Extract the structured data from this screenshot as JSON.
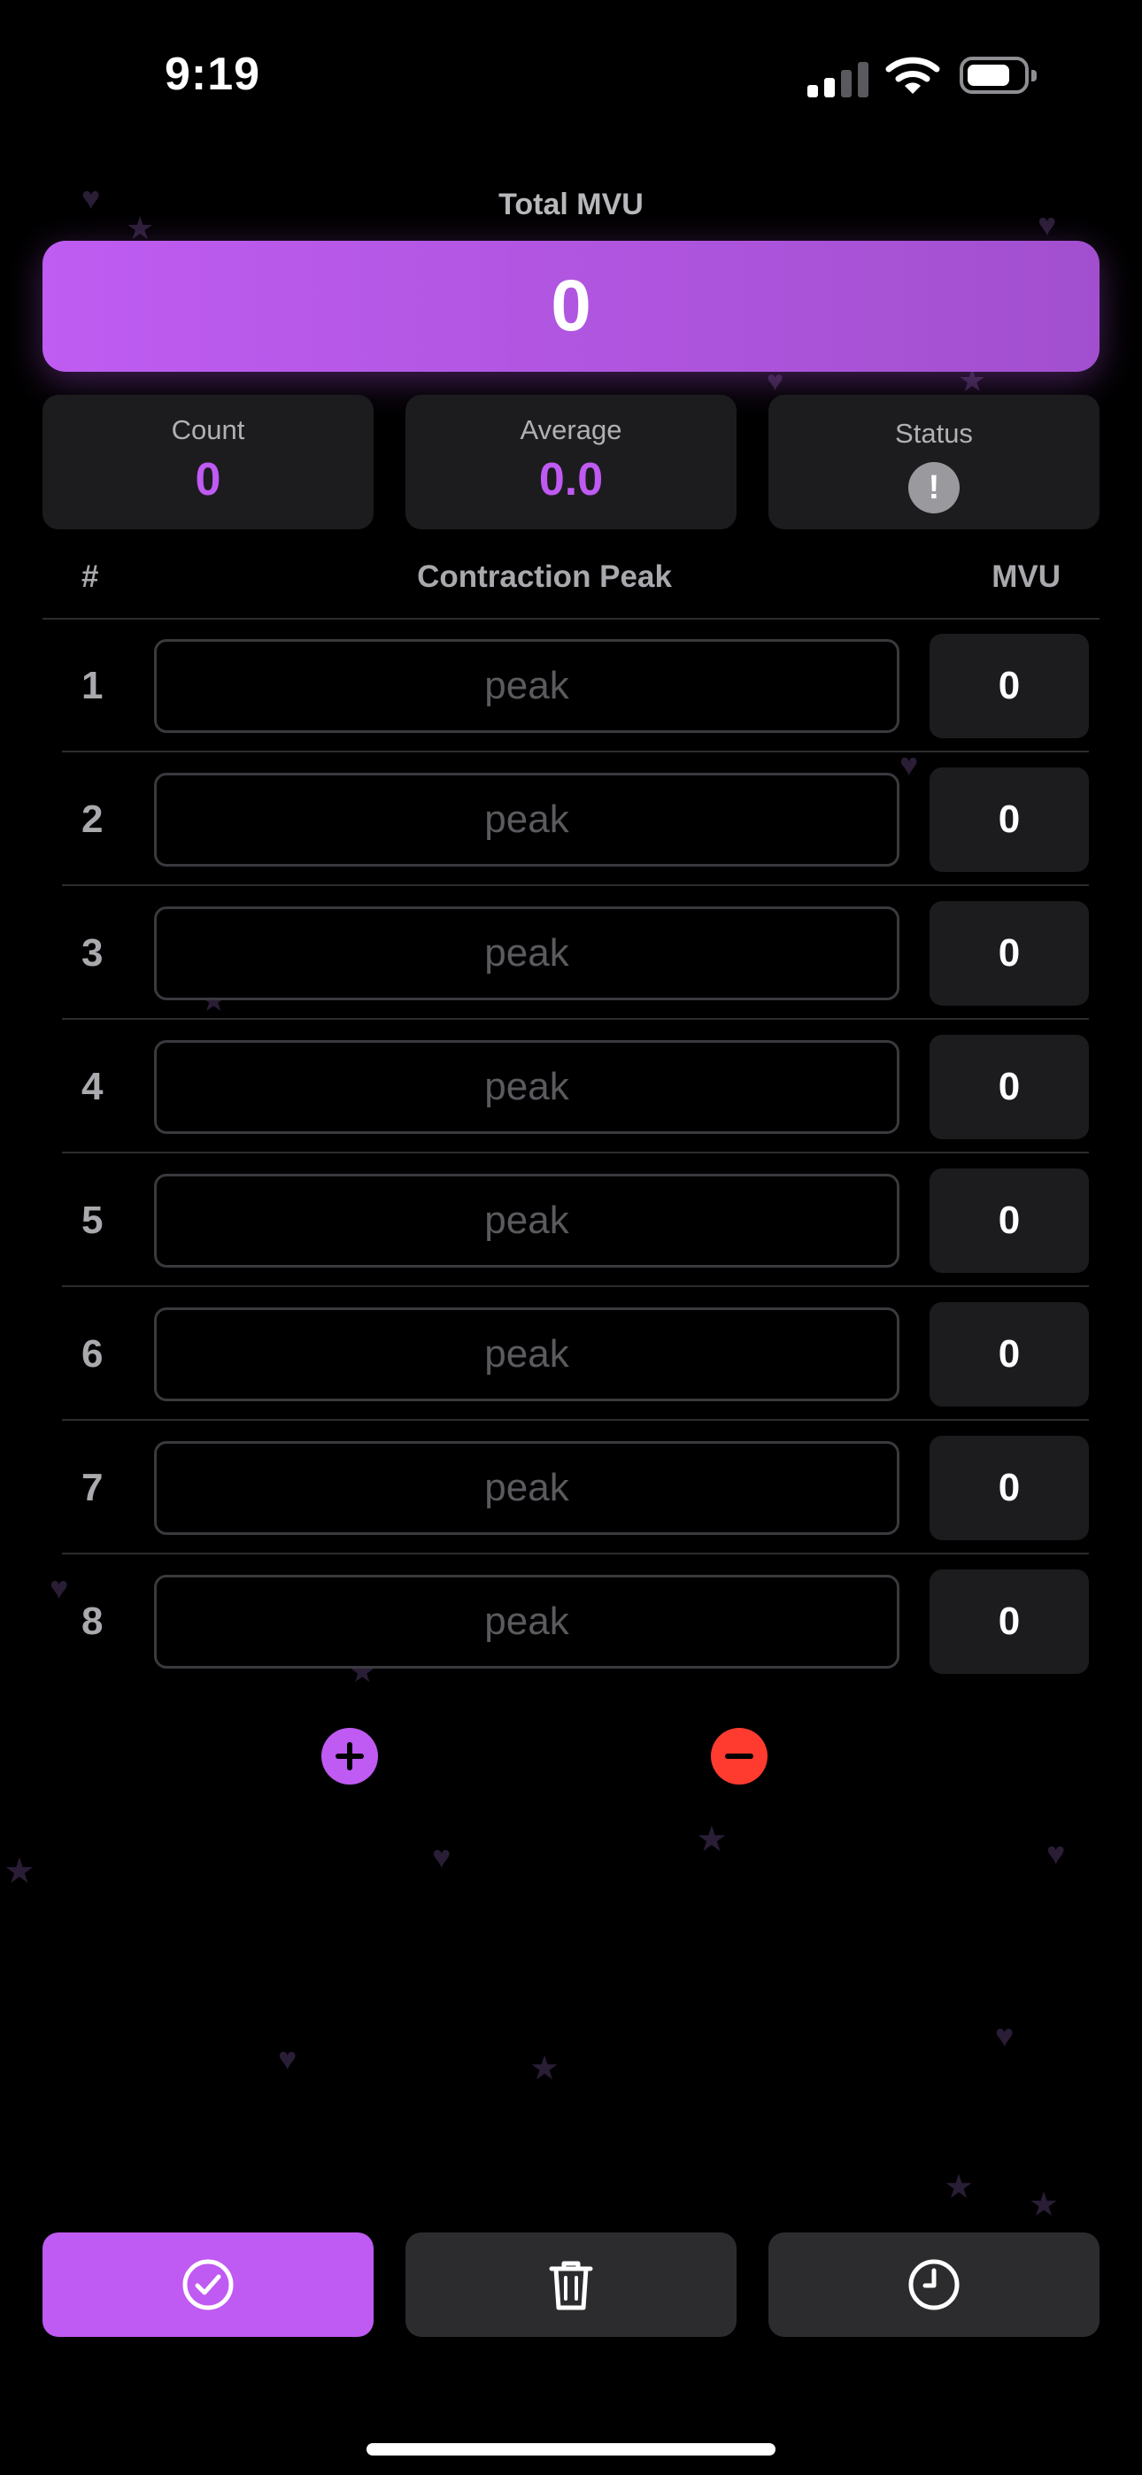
{
  "status_bar": {
    "time": "9:19",
    "signal_bars_active": 2,
    "signal_bars_total": 4,
    "battery_level": 0.75
  },
  "summary": {
    "total_label": "Total MVU",
    "total_value": "0",
    "count_label": "Count",
    "count_value": "0",
    "average_label": "Average",
    "average_value": "0.0",
    "status_label": "Status",
    "status_icon": "exclamation-circle-icon"
  },
  "table": {
    "header": {
      "index": "#",
      "peak": "Contraction Peak",
      "mvu": "MVU"
    },
    "rows": [
      {
        "index": "1",
        "peak_value": "",
        "peak_placeholder": "peak",
        "mvu": "0"
      },
      {
        "index": "2",
        "peak_value": "",
        "peak_placeholder": "peak",
        "mvu": "0"
      },
      {
        "index": "3",
        "peak_value": "",
        "peak_placeholder": "peak",
        "mvu": "0"
      },
      {
        "index": "4",
        "peak_value": "",
        "peak_placeholder": "peak",
        "mvu": "0"
      },
      {
        "index": "5",
        "peak_value": "",
        "peak_placeholder": "peak",
        "mvu": "0"
      },
      {
        "index": "6",
        "peak_value": "",
        "peak_placeholder": "peak",
        "mvu": "0"
      },
      {
        "index": "7",
        "peak_value": "",
        "peak_placeholder": "peak",
        "mvu": "0"
      },
      {
        "index": "8",
        "peak_value": "",
        "peak_placeholder": "peak",
        "mvu": "0"
      }
    ]
  },
  "row_controls": {
    "add_icon": "plus-circle-icon",
    "remove_icon": "minus-circle-icon"
  },
  "toolbar": {
    "confirm_icon": "checkmark-circle-icon",
    "delete_icon": "trash-icon",
    "history_icon": "clock-icon"
  },
  "colors": {
    "accent": "#bf5af2",
    "destructive": "#ff3b30",
    "card_background": "#1c1c1e",
    "background": "#000000"
  }
}
